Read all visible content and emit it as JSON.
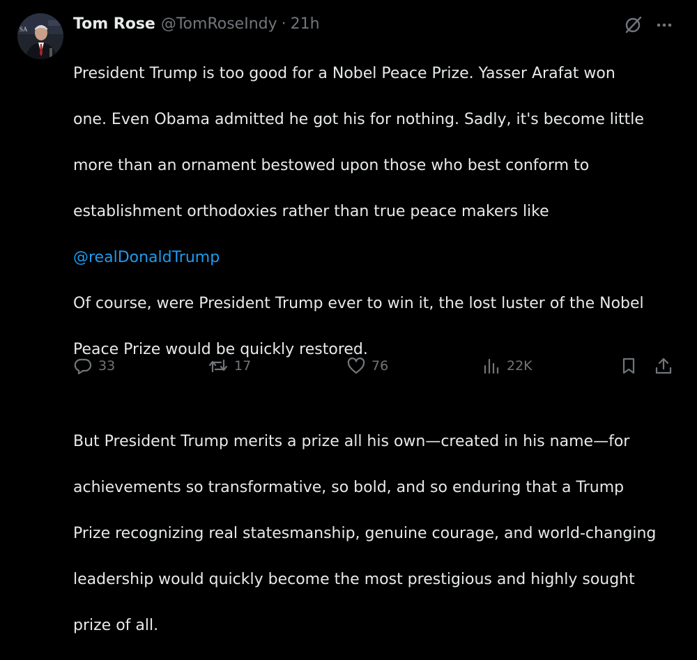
{
  "author": {
    "display_name": "Tom Rose",
    "handle": "@TomRoseIndy",
    "separator": "·",
    "time": "21h",
    "avatar_icon": "profile-photo"
  },
  "post": {
    "lines": [
      "President Trump is too good for a Nobel Peace Prize. Yasser Arafat won",
      "one. Even Obama admitted he got his for nothing. Sadly, it's become little",
      "more than an  ornament bestowed upon those who best conform to",
      "establishment orthodoxies rather than true peace makers like"
    ],
    "mention": "@realDonaldTrump",
    "lines_after_mention": [
      "Of course, were President Trump ever to win it,  the lost luster of the Nobel",
      "Peace Prize would be quickly restored."
    ],
    "paragraph_two": [
      "But President Trump merits a prize all his own—created in his name—for",
      "achievements so transformative, so bold, and so enduring that a Trump",
      "Prize recognizing real statesmanship, genuine courage, and world-changing",
      "leadership would quickly become the most prestigious and highly sought",
      "prize of all."
    ]
  },
  "actions": {
    "replies": "33",
    "reposts": "17",
    "likes": "76",
    "views": "22K"
  },
  "icons": {
    "grok": "grok-icon",
    "more": "more-icon",
    "reply": "reply-icon",
    "repost": "repost-icon",
    "like": "heart-icon",
    "views": "views-icon",
    "bookmark": "bookmark-icon",
    "share": "share-icon"
  },
  "colors": {
    "background": "#000000",
    "text": "#e7e9ea",
    "secondary_text": "#71767b",
    "link": "#1d9bf0"
  }
}
